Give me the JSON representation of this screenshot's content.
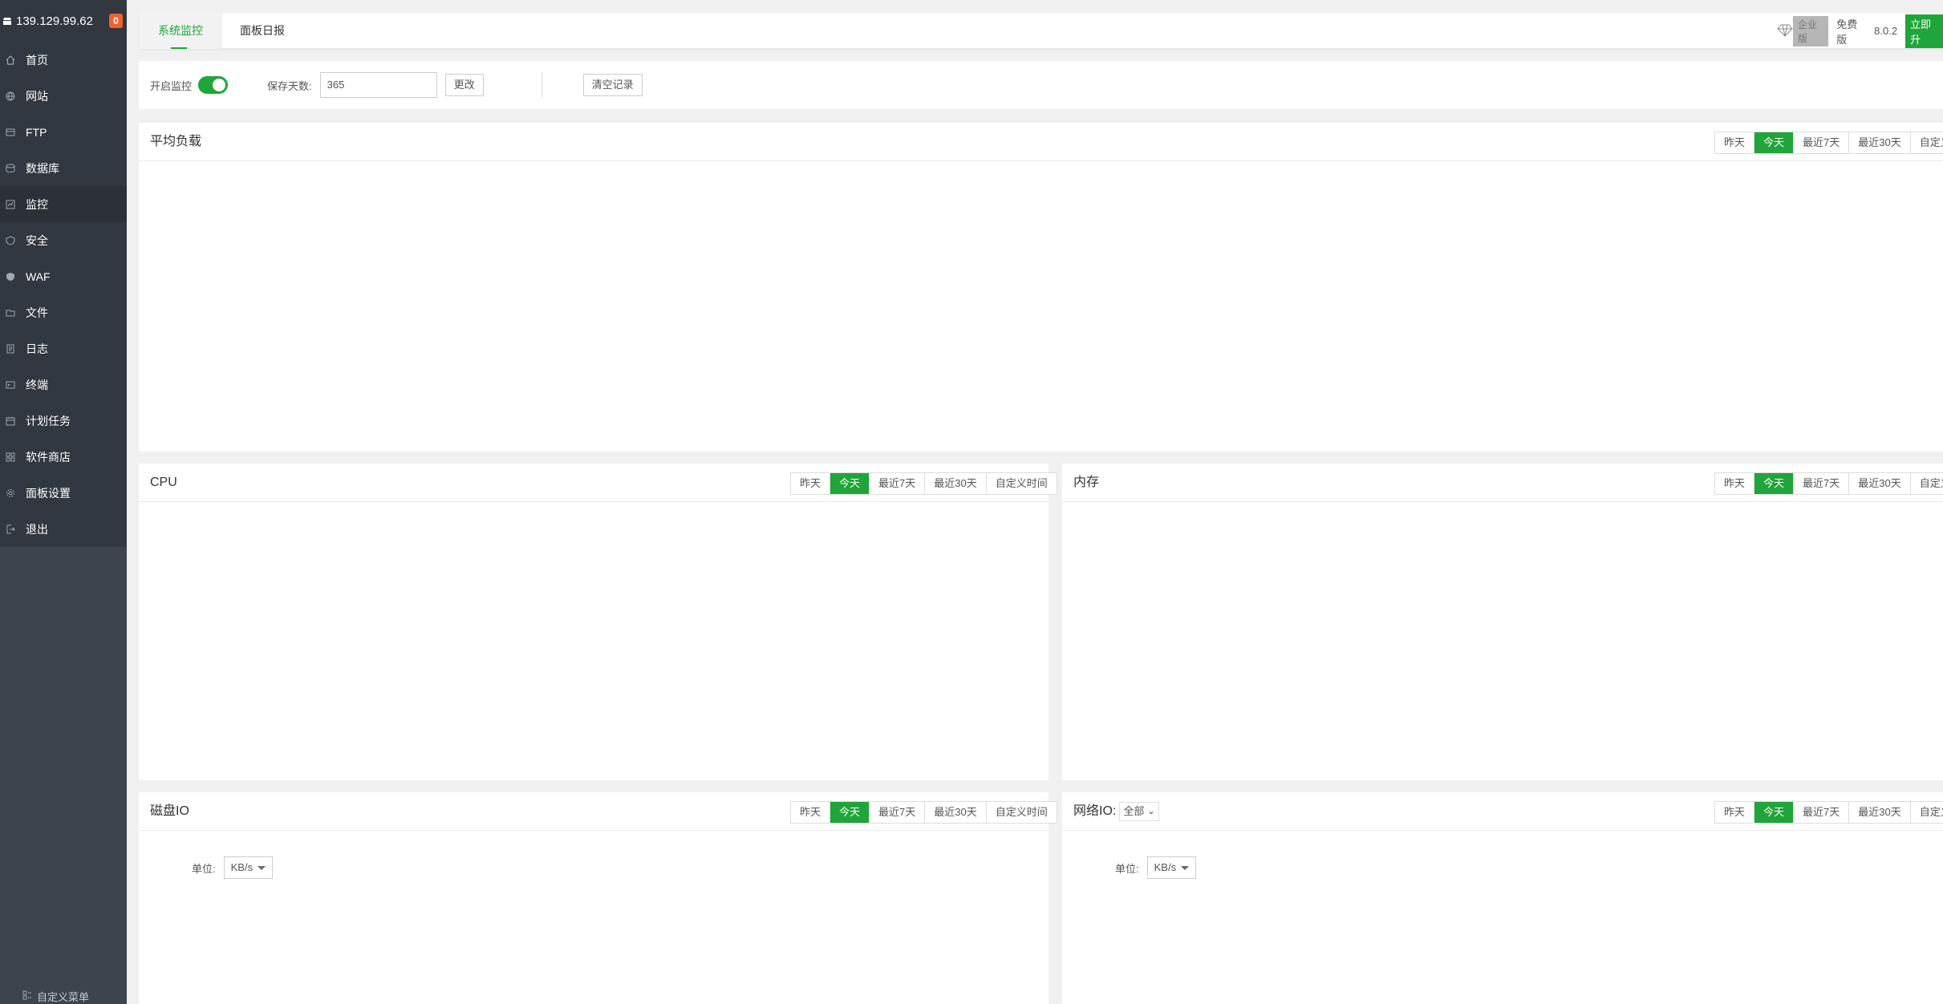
{
  "sidebar": {
    "ip": "139.129.99.62",
    "badge": "0",
    "items": [
      {
        "label": "首页"
      },
      {
        "label": "网站"
      },
      {
        "label": "FTP"
      },
      {
        "label": "数据库"
      },
      {
        "label": "监控"
      },
      {
        "label": "安全"
      },
      {
        "label": "WAF"
      },
      {
        "label": "文件"
      },
      {
        "label": "日志"
      },
      {
        "label": "终端"
      },
      {
        "label": "计划任务"
      },
      {
        "label": "软件商店"
      },
      {
        "label": "面板设置"
      },
      {
        "label": "退出"
      }
    ],
    "bottom_label": "自定义菜单"
  },
  "header": {
    "tabs": [
      {
        "label": "系统监控"
      },
      {
        "label": "面板日报"
      }
    ],
    "enterprise_label": "企业版",
    "free_label": "免费版",
    "version": "8.0.2",
    "upgrade_label": "立即升"
  },
  "controls": {
    "monitor_label": "开启监控",
    "monitor_enabled": true,
    "days_label": "保存天数:",
    "days_value": "365",
    "change_button": "更改",
    "clear_button": "清空记录"
  },
  "ranges": {
    "yesterday": "昨天",
    "today": "今天",
    "last7": "最近7天",
    "last30": "最近30天",
    "custom": "自定义时间",
    "custom_clipped": "自定义时"
  },
  "panels": {
    "load": {
      "title": "平均负载"
    },
    "cpu": {
      "title": "CPU"
    },
    "memory": {
      "title": "内存"
    },
    "disk": {
      "title": "磁盘IO",
      "unit_label": "单位:",
      "unit_value": "KB/s"
    },
    "network": {
      "title": "网络IO:",
      "filter_value": "全部",
      "unit_label": "单位:",
      "unit_value": "KB/s"
    }
  },
  "colors": {
    "accent": "#20a53a",
    "sidebar": "#3c444d",
    "badge": "#f0622f"
  }
}
